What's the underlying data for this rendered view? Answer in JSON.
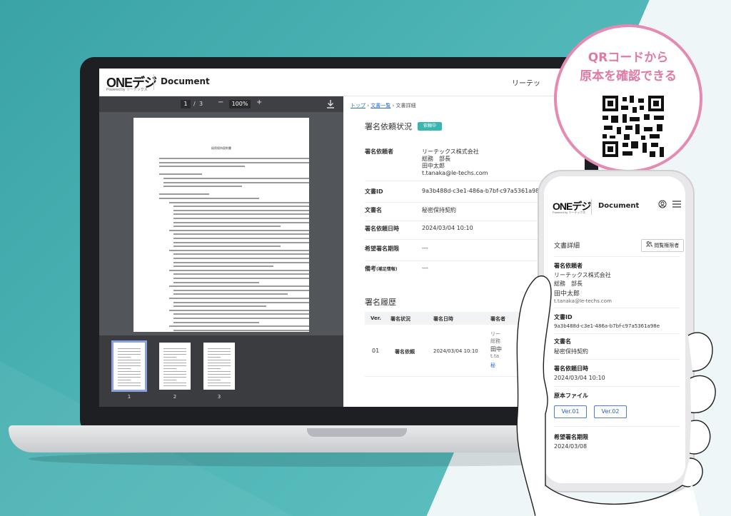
{
  "bubble": {
    "line1": "QRコードから",
    "line2": "原本を確認できる"
  },
  "laptop": {
    "header": {
      "logo": "ONEデジ",
      "logo_sub": "Powered by リーテックス",
      "app_title": "Document",
      "user_name": "リーテッ"
    },
    "viewer": {
      "page_current": "1",
      "page_sep": "/",
      "page_total": "3",
      "minus": "−",
      "zoom": "100%",
      "plus": "+",
      "doc_title": "秘密保持契約書",
      "thumbs": [
        "1",
        "2",
        "3"
      ]
    },
    "detail": {
      "breadcrumb": {
        "top": "トップ",
        "list": "文書一覧",
        "current": "文書詳細"
      },
      "status_title": "署名依頼状況",
      "status_badge": "依頼中",
      "fields": {
        "requester_label": "署名依頼者",
        "requester_company": "リーテックス株式会社",
        "requester_dept": "総務　部長",
        "requester_name": "田中太郎",
        "requester_email": "t.tanaka@le-techs.com",
        "docid_label": "文書ID",
        "docid_value": "9a3b488d-c3e1-486a-b7bf-c97a5361a98e",
        "docname_label": "文書名",
        "docname_value": "秘密保持契約",
        "reqdate_label": "署名依頼日時",
        "reqdate_value": "2024/03/04  10:10",
        "deadline_label": "希望署名期限",
        "deadline_value": "---",
        "remarks_label": "備考",
        "remarks_suffix": "(補足情報)",
        "remarks_value": "---"
      },
      "history": {
        "title": "署名履歴",
        "headers": [
          "Ver.",
          "署名状況",
          "署名日時",
          "署名者"
        ],
        "row": {
          "ver": "01",
          "status": "署名依頼",
          "date": "2024/03/04  10:10",
          "signer_1": "リー",
          "signer_2": "総務",
          "signer_3": "田中",
          "signer_4": "t.ta",
          "link": "秘"
        }
      }
    }
  },
  "phone": {
    "logo": "ONEデジ",
    "logo_sub": "Powered by リーテックス",
    "app_title": "Document",
    "section_title": "文書詳細",
    "viewer_button": "閲覧権限者",
    "requester_label": "署名依頼者",
    "requester_company": "リーテックス株式会社",
    "requester_dept": "総務　部長",
    "requester_name": "田中太郎",
    "requester_email": "t.tanaka@le-techs.com",
    "docid_label": "文書ID",
    "docid_value": "9a3b488d-c3e1-486a-b7bf-c97a5361a98e",
    "docname_label": "文書名",
    "docname_value": "秘密保持契約",
    "reqdate_label": "署名依頼日時",
    "reqdate_value": "2024/03/04  10:10",
    "original_label": "原本ファイル",
    "ver1": "Ver.01",
    "ver2": "Ver.02",
    "deadline_label": "希望署名期限",
    "deadline_value": "2024/03/08"
  },
  "colors": {
    "accent": "#3ab6b1",
    "bubble": "#e58ab3",
    "link": "#2a6dd9"
  }
}
